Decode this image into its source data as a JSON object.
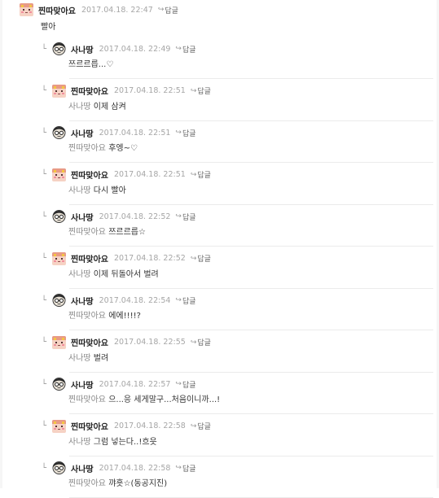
{
  "thread": {
    "top": {
      "author": "찐따맞아요",
      "avatar": "pink",
      "date": "2017.04.18. 22:47",
      "reply_label": "답글",
      "text": "빨아"
    },
    "replies": [
      {
        "author": "사나땅",
        "avatar": "glasses",
        "date": "2017.04.18. 22:49",
        "reply_label": "답글",
        "mention": "",
        "text": "쯔르르릅...♡"
      },
      {
        "author": "찐따맞아요",
        "avatar": "pink",
        "date": "2017.04.18. 22:51",
        "reply_label": "답글",
        "mention": "사나땅",
        "text": "이제 삼켜"
      },
      {
        "author": "사나땅",
        "avatar": "glasses",
        "date": "2017.04.18. 22:51",
        "reply_label": "답글",
        "mention": "찐따맞아요",
        "text": "후엥~♡"
      },
      {
        "author": "찐따맞아요",
        "avatar": "pink",
        "date": "2017.04.18. 22:51",
        "reply_label": "답글",
        "mention": "사나땅",
        "text": "다시 빨아"
      },
      {
        "author": "사나땅",
        "avatar": "glasses",
        "date": "2017.04.18. 22:52",
        "reply_label": "답글",
        "mention": "찐따맞아요",
        "text": "쯔르르릅☆"
      },
      {
        "author": "찐따맞아요",
        "avatar": "pink",
        "date": "2017.04.18. 22:52",
        "reply_label": "답글",
        "mention": "사나땅",
        "text": "이제 뒤돌아서 벌려"
      },
      {
        "author": "사나땅",
        "avatar": "glasses",
        "date": "2017.04.18. 22:54",
        "reply_label": "답글",
        "mention": "찐따맞아요",
        "text": "에에!!!!?"
      },
      {
        "author": "찐따맞아요",
        "avatar": "pink",
        "date": "2017.04.18. 22:55",
        "reply_label": "답글",
        "mention": "사나땅",
        "text": "벌려"
      },
      {
        "author": "사나땅",
        "avatar": "glasses",
        "date": "2017.04.18. 22:57",
        "reply_label": "답글",
        "mention": "찐따맞아요",
        "text": "으...응 세게말구...처음이니까...!"
      },
      {
        "author": "찐따맞아요",
        "avatar": "pink",
        "date": "2017.04.18. 22:58",
        "reply_label": "답글",
        "mention": "사나땅",
        "text": "그럼 넣는다..!흐읏"
      },
      {
        "author": "사나땅",
        "avatar": "glasses",
        "date": "2017.04.18. 22:58",
        "reply_label": "답글",
        "mention": "찐따맞아요",
        "text": "꺄흣☆(동공지진)"
      }
    ]
  }
}
